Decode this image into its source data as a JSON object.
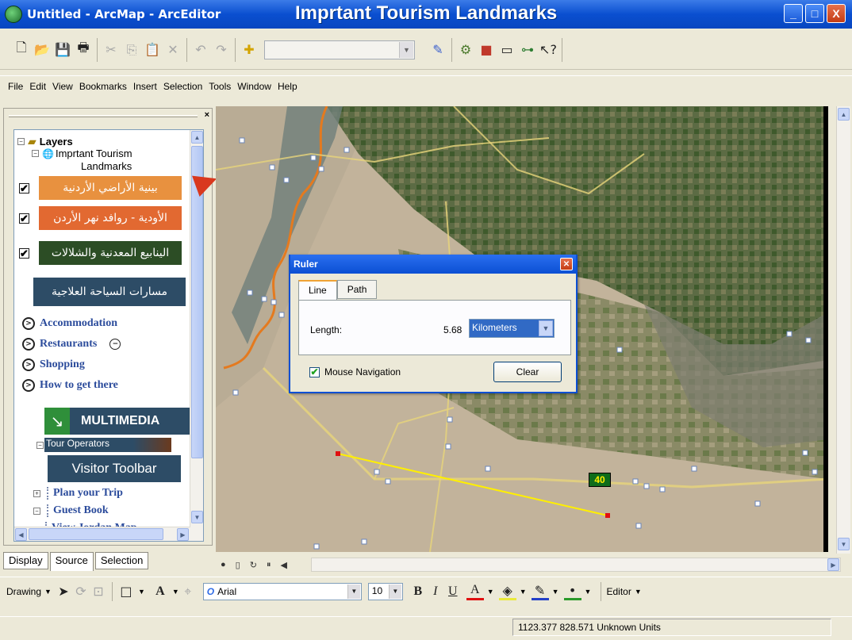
{
  "window": {
    "app_title": "Untitled - ArcMap - ArcEditor",
    "doc_title": "Imprtant Tourism Landmarks",
    "controls": [
      "_",
      "□",
      "X"
    ]
  },
  "toolbar_main": {
    "icons": [
      "new-icon",
      "open-icon",
      "save-icon",
      "print-icon",
      "cut-icon",
      "copy-icon",
      "paste-icon",
      "delete-icon",
      "undo-icon",
      "redo-icon",
      "add-data-icon",
      "scale-combo",
      "editor-toolbar-icon",
      "arctoolbox-icon",
      "arccatalog-icon",
      "window-icon",
      "python-icon",
      "whats-this-icon"
    ],
    "scale_value": ""
  },
  "menu": {
    "items": [
      "File",
      "Edit",
      "View",
      "Bookmarks",
      "Insert",
      "Selection",
      "Tools",
      "Window",
      "Help"
    ]
  },
  "toc": {
    "root_label": "Layers",
    "group_label_1": "Imprtant Tourism",
    "group_label_2": "Landmarks",
    "arabic_layers": [
      {
        "label": "بينية الأراضي الأردنية",
        "color": "#e8913f"
      },
      {
        "label": "الأودية - روافد نهر الأردن",
        "color": "#e26931"
      },
      {
        "label": "الينابيع المعدنية والشلالات",
        "color": "#2c4d25"
      }
    ],
    "arabic_banner": {
      "label": "مسارات السياحة العلاجية",
      "color": "#2d4c66"
    },
    "links": [
      "Accommodation",
      "Restaurants",
      "Shopping",
      "How to get there"
    ],
    "multimedia_label": "MULTIMEDIA",
    "tour_operators_label": "Tour Operators",
    "visitor_toolbar_label": "Visitor Toolbar",
    "bottom_links": [
      "Plan your Trip",
      "Guest Book",
      "View Jordan Map"
    ],
    "tabs": [
      "Display",
      "Source",
      "Selection"
    ],
    "active_tab": "Source"
  },
  "ruler": {
    "title": "Ruler",
    "tabs": [
      "Line",
      "Path"
    ],
    "active_tab": "Line",
    "length_label": "Length:",
    "length_value": "5.68",
    "units": "Kilometers",
    "mouse_navigation_label": "Mouse Navigation",
    "mouse_navigation_checked": true,
    "clear_label": "Clear"
  },
  "map": {
    "route_badge": "40"
  },
  "toolbar_drawing": {
    "drawing_label": "Drawing",
    "font_name": "Arial",
    "font_size": "10",
    "bold": "B",
    "italic": "I",
    "underline": "U",
    "font_color_glyph": "A",
    "editor_label": "Editor"
  },
  "status": {
    "coords": "1123.377  828.571 Unknown Units"
  }
}
